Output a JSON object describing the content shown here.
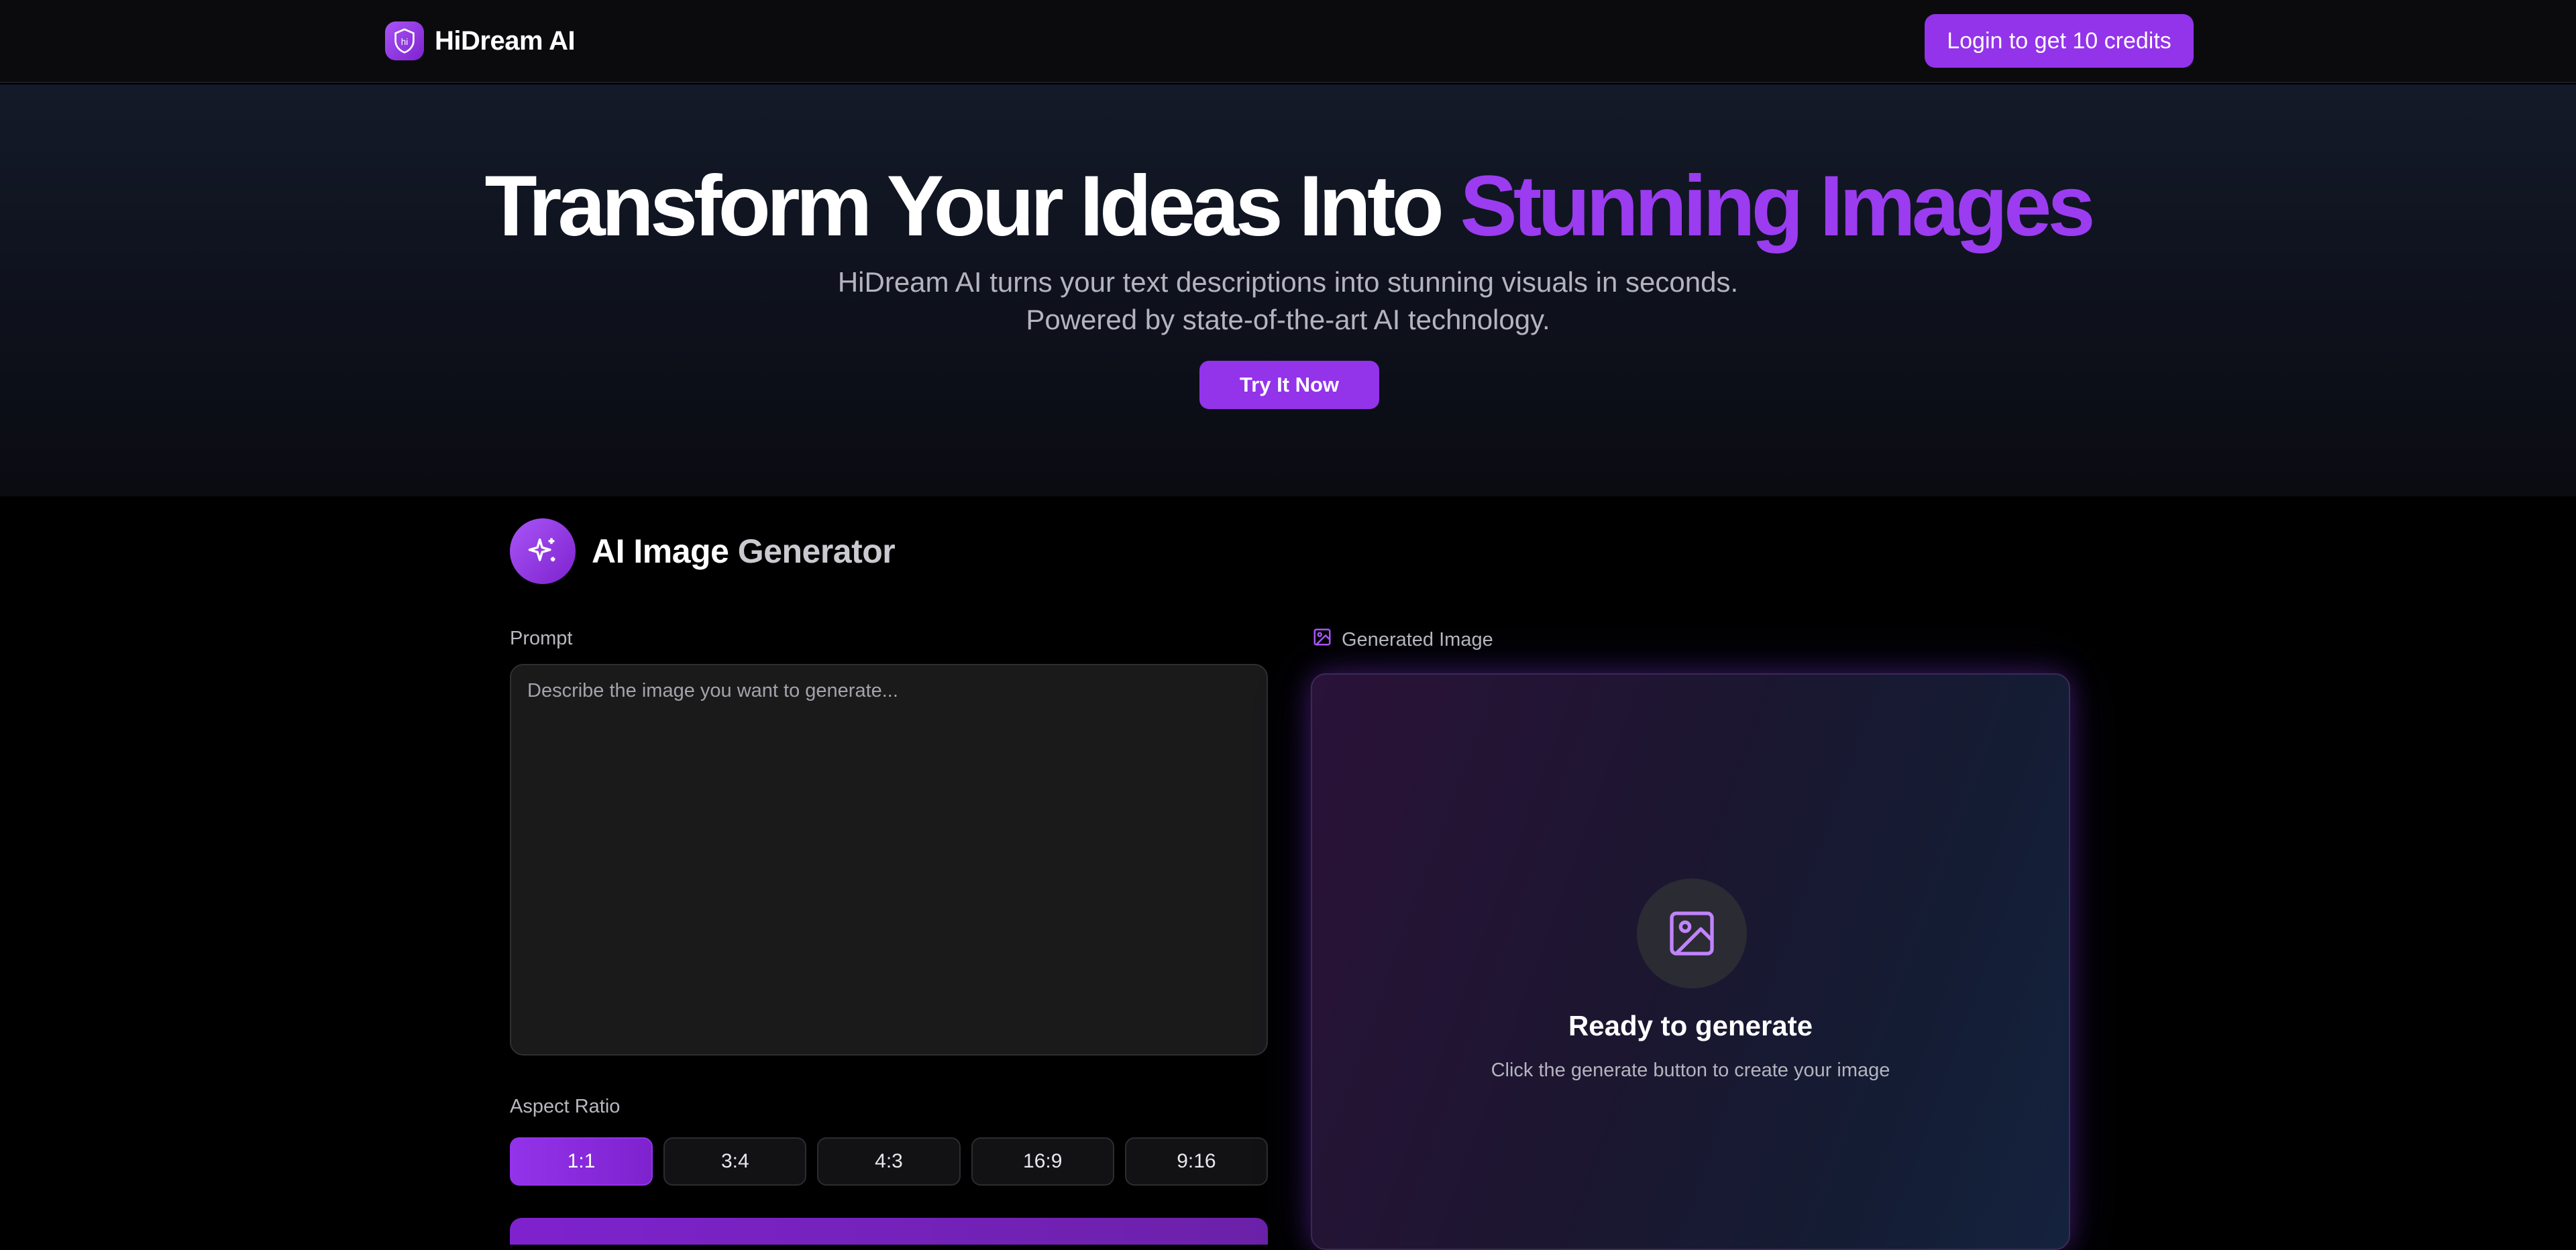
{
  "nav": {
    "brand_name": "HiDream AI",
    "logo_icon": "hi-shield-logo",
    "login_label": "Login to get 10 credits"
  },
  "hero": {
    "title_main": "Transform Your Ideas Into ",
    "title_accent": "Stunning Images",
    "subtitle_line1": "HiDream AI turns your text descriptions into stunning visuals in seconds.",
    "subtitle_line2": "Powered by state-of-the-art AI technology.",
    "cta_label": "Try It Now"
  },
  "generator": {
    "icon": "sparkles-icon",
    "title_main": "AI Image ",
    "title_muted": "Generator",
    "prompt_label": "Prompt",
    "prompt_placeholder": "Describe the image you want to generate...",
    "prompt_value": "",
    "aspect_label": "Aspect Ratio",
    "ratios": [
      "1:1",
      "3:4",
      "4:3",
      "16:9",
      "9:16"
    ],
    "selected_ratio": "1:1"
  },
  "result": {
    "label": "Generated Image",
    "label_icon": "image-icon",
    "ready_icon": "image-icon",
    "ready_title": "Ready to generate",
    "ready_sub": "Click the generate button to create your image"
  },
  "colors": {
    "accent": "#9333ea",
    "accent_text": "#9b3cf0",
    "background": "#000000",
    "navbar": "#0b0b0d"
  }
}
